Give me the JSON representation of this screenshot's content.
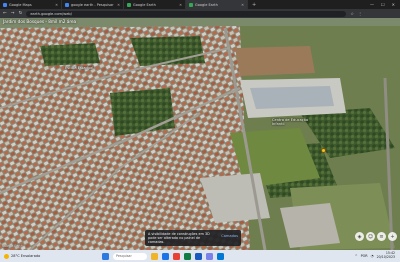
{
  "browser": {
    "tabs": [
      {
        "label": "Google Maps",
        "active": false
      },
      {
        "label": "google earth - Pesquisar",
        "active": false
      },
      {
        "label": "Google Earth",
        "active": false
      },
      {
        "label": "Google Earth",
        "active": true
      }
    ],
    "address": "earth.google.com/web/"
  },
  "map": {
    "place_title": "Jardim dos Bosques - 8mil m2 área",
    "labels": {
      "school_label": "Escola Estadual",
      "center_label": "Centro de Educação\nInfantil"
    },
    "toast": {
      "message": "A visibilidade de construções em 3D pode ser alterada no painel de camadas.",
      "action": "Camadas"
    },
    "controls": [
      "compass-icon",
      "person-icon",
      "layers-icon",
      "plus-icon"
    ],
    "attribution": "Google Earth"
  },
  "taskbar": {
    "weather": "28°C Ensolarado",
    "search_placeholder": "Pesquisar",
    "tray_lang": "POR",
    "time": "15:42",
    "date": "20/10/2023"
  },
  "colors": {
    "tab_bar": "#1f1f1f",
    "active_tab": "#35363a",
    "taskbar": "#dfe6f0",
    "pin": "#f2c12e"
  }
}
